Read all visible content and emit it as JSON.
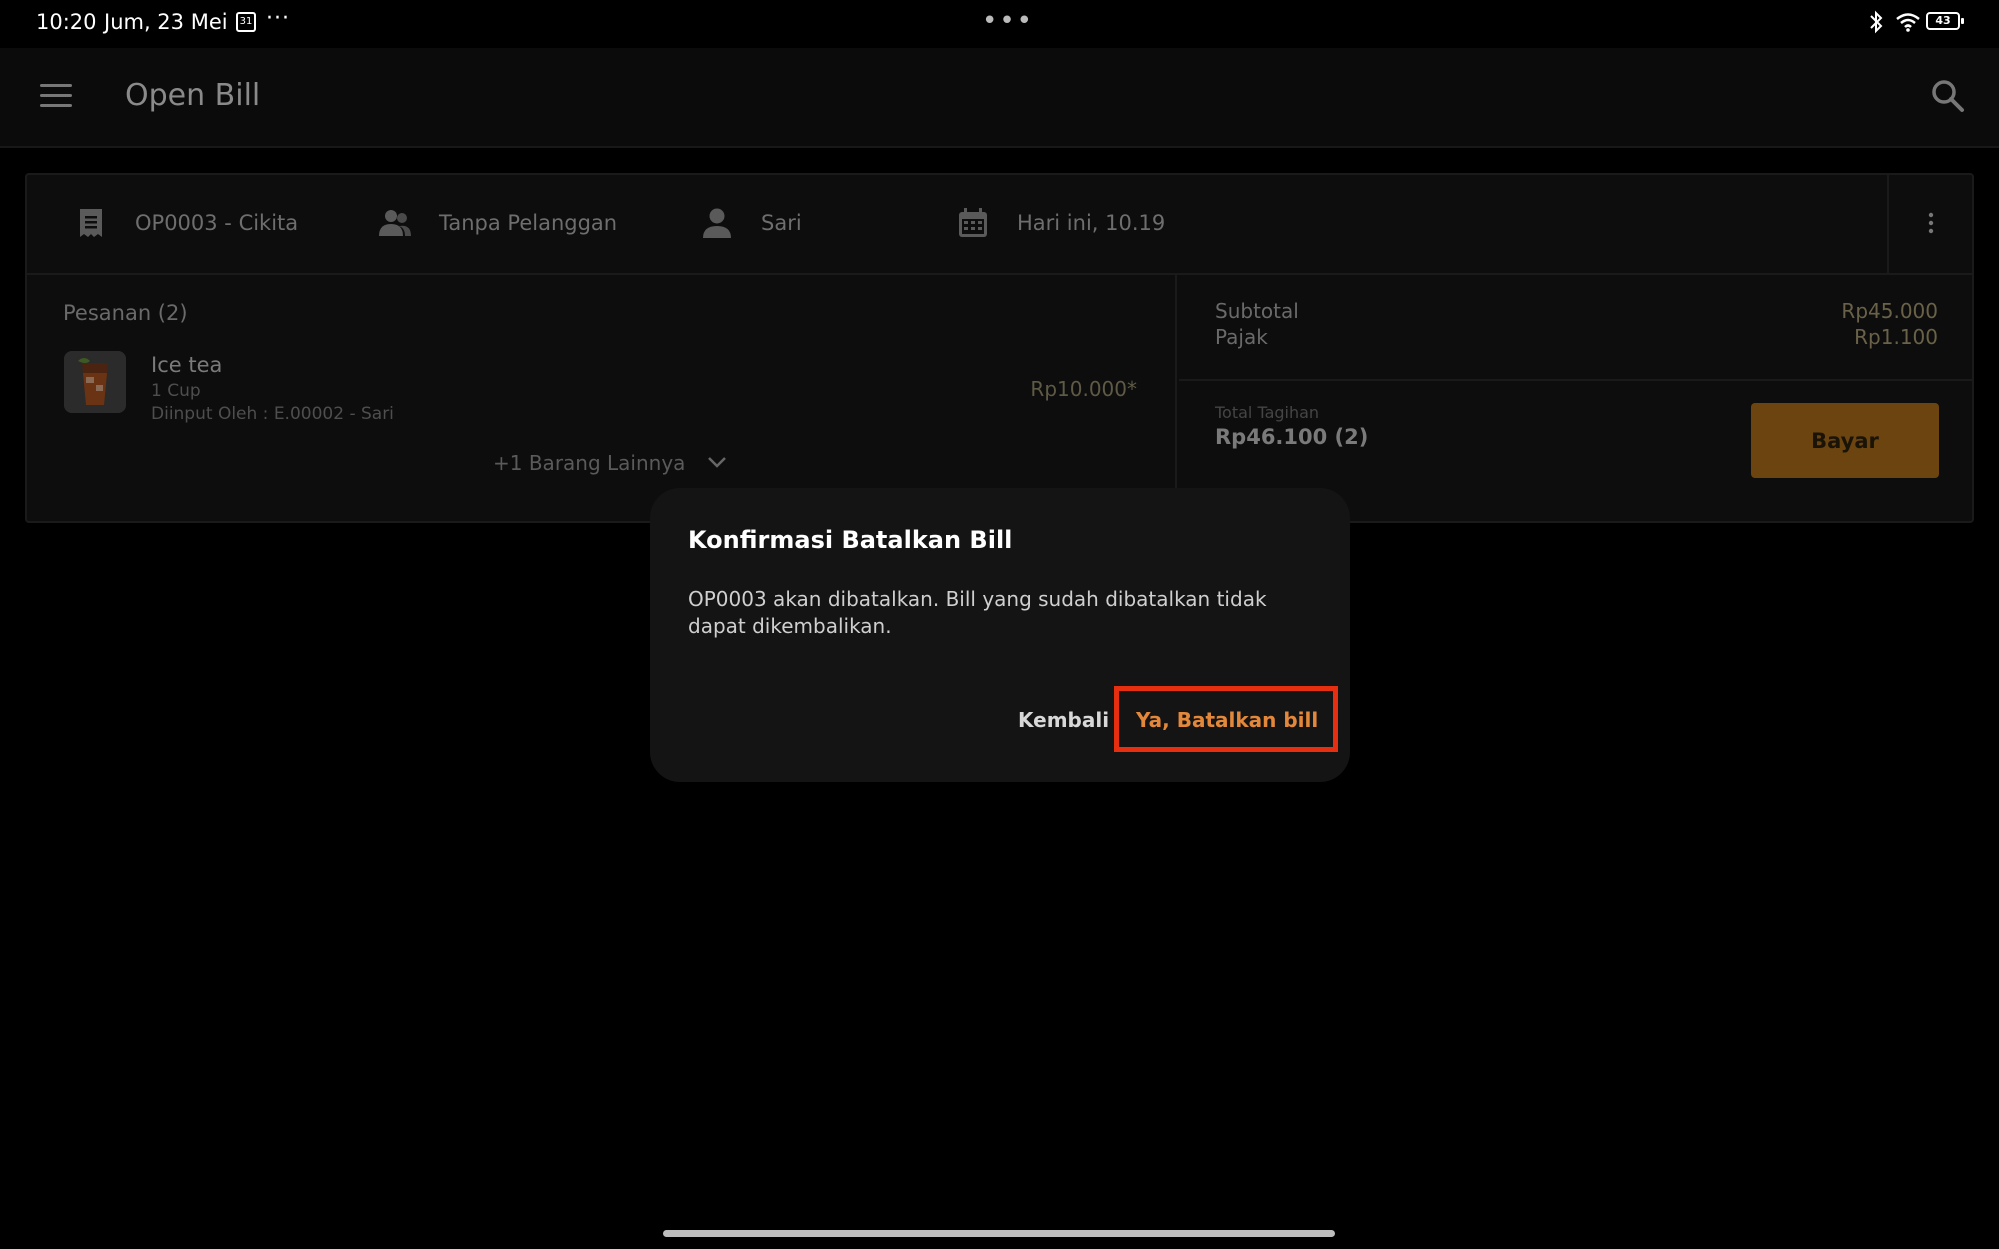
{
  "status_bar": {
    "time": "10:20",
    "date": "Jum, 23 Mei",
    "calendar_badge": "31",
    "overflow": "···",
    "center_dots": "•••",
    "battery": "43"
  },
  "app_bar": {
    "title": "Open Bill"
  },
  "bill": {
    "id_label": "OP0003 - Cikita",
    "customer": "Tanpa Pelanggan",
    "staff": "Sari",
    "date": "Hari ini, 10.19"
  },
  "orders": {
    "title": "Pesanan (2)",
    "items": [
      {
        "name": "Ice tea",
        "qty": "1 Cup",
        "entered_by": "Diinput Oleh : E.00002 - Sari",
        "price": "Rp10.000*"
      }
    ],
    "more_label": "+1 Barang Lainnya"
  },
  "summary": {
    "subtotal_label": "Subtotal",
    "subtotal_value": "Rp45.000",
    "tax_label": "Pajak",
    "tax_value": "Rp1.100",
    "total_label": "Total Tagihan",
    "total_value": "Rp46.100 (2)",
    "pay_label": "Bayar"
  },
  "dialog": {
    "title": "Konfirmasi Batalkan Bill",
    "message": "OP0003 akan dibatalkan. Bill yang sudah dibatalkan tidak dapat dikembalikan.",
    "back_label": "Kembali",
    "confirm_label": "Ya, Batalkan bill"
  },
  "colors": {
    "accent_orange": "#e3873a",
    "highlight_red": "#e52f10",
    "pay_button": "#6b4410"
  }
}
